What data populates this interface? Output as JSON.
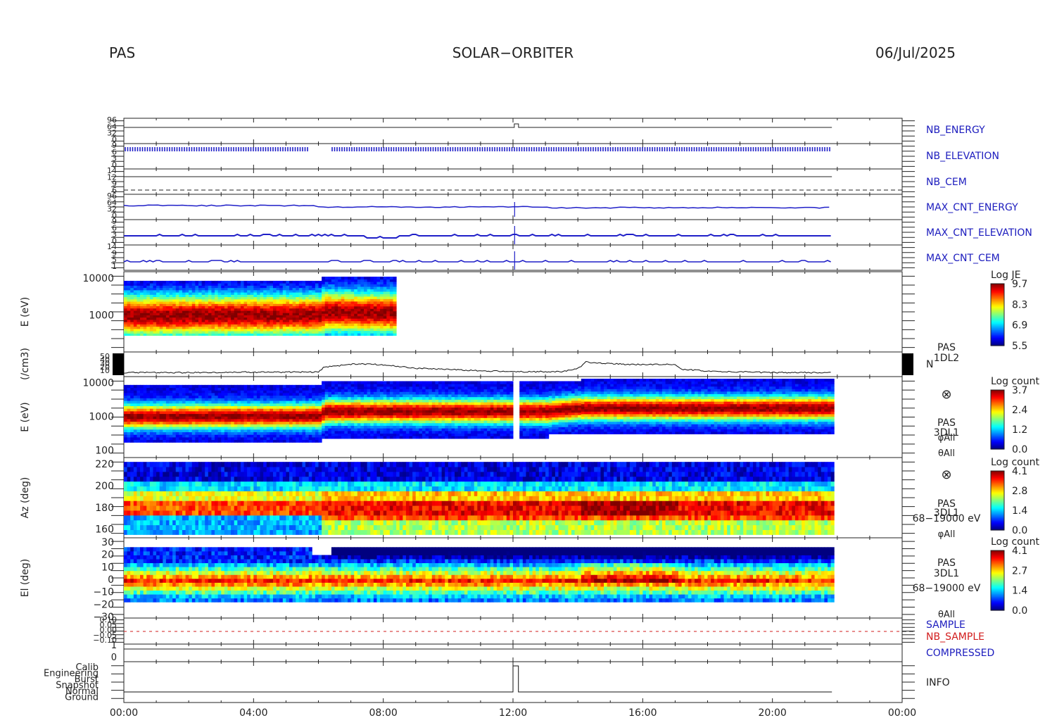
{
  "header": {
    "left": "PAS",
    "center": "SOLAR−ORBITER",
    "right": "06/Jul/2025"
  },
  "chart_data": {
    "type": "multi-panel time series and spectrogram",
    "time_axis": {
      "range": [
        "00:00",
        "24:00"
      ],
      "tick_labels": [
        "00:00",
        "04:00",
        "08:00",
        "12:00",
        "16:00",
        "20:00",
        "00:00"
      ],
      "data_end": "21:50"
    },
    "panels": [
      {
        "id": "nb_energy",
        "type": "line",
        "ylabels": [
          "96",
          "64",
          "32",
          "0"
        ],
        "right_label": "NB_ENERGY",
        "value": 0,
        "spike_at": "12:05"
      },
      {
        "id": "nb_elevation",
        "type": "dense-ticks",
        "ylabels": [
          "9",
          "6",
          "3",
          "0"
        ],
        "right_label": "NB_ELEVATION",
        "gap": [
          "05:40",
          "06:25"
        ]
      },
      {
        "id": "nb_cem",
        "type": "line",
        "ylabels": [
          "14",
          "12",
          "9",
          "6"
        ],
        "right_label": "NB_CEM"
      },
      {
        "id": "max_cnt_energy",
        "type": "line",
        "ylabels": [
          "96",
          "64",
          "32",
          "0"
        ],
        "right_label": "MAX_CNT_ENERGY"
      },
      {
        "id": "max_cnt_elevation",
        "type": "line",
        "ylabels": [
          "9",
          "6",
          "3",
          "0"
        ],
        "right_label": "MAX_CNT_ELEVATION"
      },
      {
        "id": "max_cnt_cem",
        "type": "line",
        "ylabels": [
          "14",
          "9",
          "5",
          "1"
        ],
        "right_label": "MAX_CNT_CEM"
      },
      {
        "id": "je_spectrogram",
        "type": "heatmap",
        "ylabel": "E (eV)",
        "yticks": [
          "10000",
          "1000"
        ],
        "y_log_range": [
          100,
          15000
        ],
        "time_range": [
          "00:00",
          "08:20"
        ],
        "colorbar": {
          "title": "Log JE",
          "ticks": [
            "9.7",
            "8.3",
            "6.9",
            "5.5"
          ]
        },
        "peak_energy_eV": [
          [
            "00:00",
            900
          ],
          [
            "06:00",
            950
          ],
          [
            "06:10",
            1150
          ],
          [
            "08:20",
            1050
          ]
        ]
      },
      {
        "id": "density",
        "type": "line",
        "ylabel": "(/cm3)",
        "yticks": [
          "50",
          "40",
          "30",
          "20",
          "10"
        ],
        "right_label": "PAS\n1DL2",
        "right_symbol": "N",
        "points": [
          [
            "00:00",
            6
          ],
          [
            "02:00",
            6
          ],
          [
            "04:00",
            7
          ],
          [
            "06:00",
            7
          ],
          [
            "06:10",
            18
          ],
          [
            "07:10",
            26
          ],
          [
            "08:00",
            24
          ],
          [
            "09:00",
            16
          ],
          [
            "10:00",
            13
          ],
          [
            "11:00",
            10
          ],
          [
            "12:00",
            8
          ],
          [
            "13:30",
            8
          ],
          [
            "14:00",
            15
          ],
          [
            "14:15",
            30
          ],
          [
            "15:00",
            26
          ],
          [
            "16:00",
            24
          ],
          [
            "17:00",
            25
          ],
          [
            "17:10",
            14
          ],
          [
            "18:00",
            9
          ],
          [
            "20:00",
            6
          ],
          [
            "21:50",
            6
          ]
        ]
      },
      {
        "id": "energy_spectrogram",
        "type": "heatmap",
        "ylabel": "E (eV)",
        "yticks": [
          "10000",
          "1000",
          "100"
        ],
        "y_log_range": [
          60,
          15000
        ],
        "time_range": [
          "00:00",
          "21:50"
        ],
        "labels": [
          "PAS",
          "3DL1",
          "φAll",
          "θAll"
        ],
        "colorbar": {
          "title": "Log count",
          "ticks": [
            "3.7",
            "2.4",
            "1.2",
            "0.0"
          ]
        },
        "peak_energy_eV": [
          [
            "00:00",
            900
          ],
          [
            "06:00",
            950
          ],
          [
            "06:10",
            1300
          ],
          [
            "12:00",
            1300
          ],
          [
            "13:00",
            1300
          ],
          [
            "14:00",
            1600
          ],
          [
            "21:50",
            1600
          ]
        ]
      },
      {
        "id": "azimuth_spectrogram",
        "type": "heatmap",
        "ylabel": "Az (deg)",
        "yticks": [
          "220",
          "200",
          "180",
          "160"
        ],
        "y_range": [
          152,
          226
        ],
        "time_range": [
          "00:00",
          "21:50"
        ],
        "labels": [
          "PAS",
          "3DL1",
          "68−19000 eV",
          "φAll"
        ],
        "colorbar": {
          "title": "Log count",
          "ticks": [
            "4.1",
            "2.8",
            "1.4",
            "0.0"
          ]
        }
      },
      {
        "id": "elevation_spectrogram",
        "type": "heatmap",
        "ylabel": "El (deg)",
        "yticks": [
          "30",
          "20",
          "10",
          "0",
          "−10",
          "−20",
          "−30"
        ],
        "y_range": [
          -30,
          30
        ],
        "time_range": [
          "00:00",
          "21:50"
        ],
        "labels": [
          "PAS",
          "3DL1",
          "68−19000 eV",
          "θAll"
        ],
        "colorbar": {
          "title": "Log count",
          "ticks": [
            "4.1",
            "2.7",
            "1.4",
            "0.0"
          ]
        }
      },
      {
        "id": "sample",
        "type": "line",
        "ylabels": [
          "0.10",
          "0.05",
          "0.00",
          "−0.05",
          "−0.10"
        ],
        "right_labels": [
          "SAMPLE",
          "NB_SAMPLE"
        ],
        "value": 0
      },
      {
        "id": "compressed",
        "type": "line",
        "ylabels": [
          "1",
          "0"
        ],
        "right_label": "COMPRESSED",
        "value": 1
      },
      {
        "id": "info",
        "type": "step",
        "ylabels": [
          "Calib",
          "Engineering",
          "Burst",
          "Snapshot",
          "Normal",
          "Ground"
        ],
        "right_label": "INFO",
        "points": [
          [
            "12:00",
            "Normal"
          ],
          [
            "12:00",
            "Calib"
          ],
          [
            "12:10",
            "Calib"
          ],
          [
            "12:10",
            "Normal"
          ],
          [
            "21:50",
            "Normal"
          ]
        ]
      }
    ]
  },
  "colors": {
    "blue_label": "#1c1cbe",
    "red_label": "#d21c1c",
    "trace_blue": "#1f1fc8",
    "black": "#000000"
  }
}
